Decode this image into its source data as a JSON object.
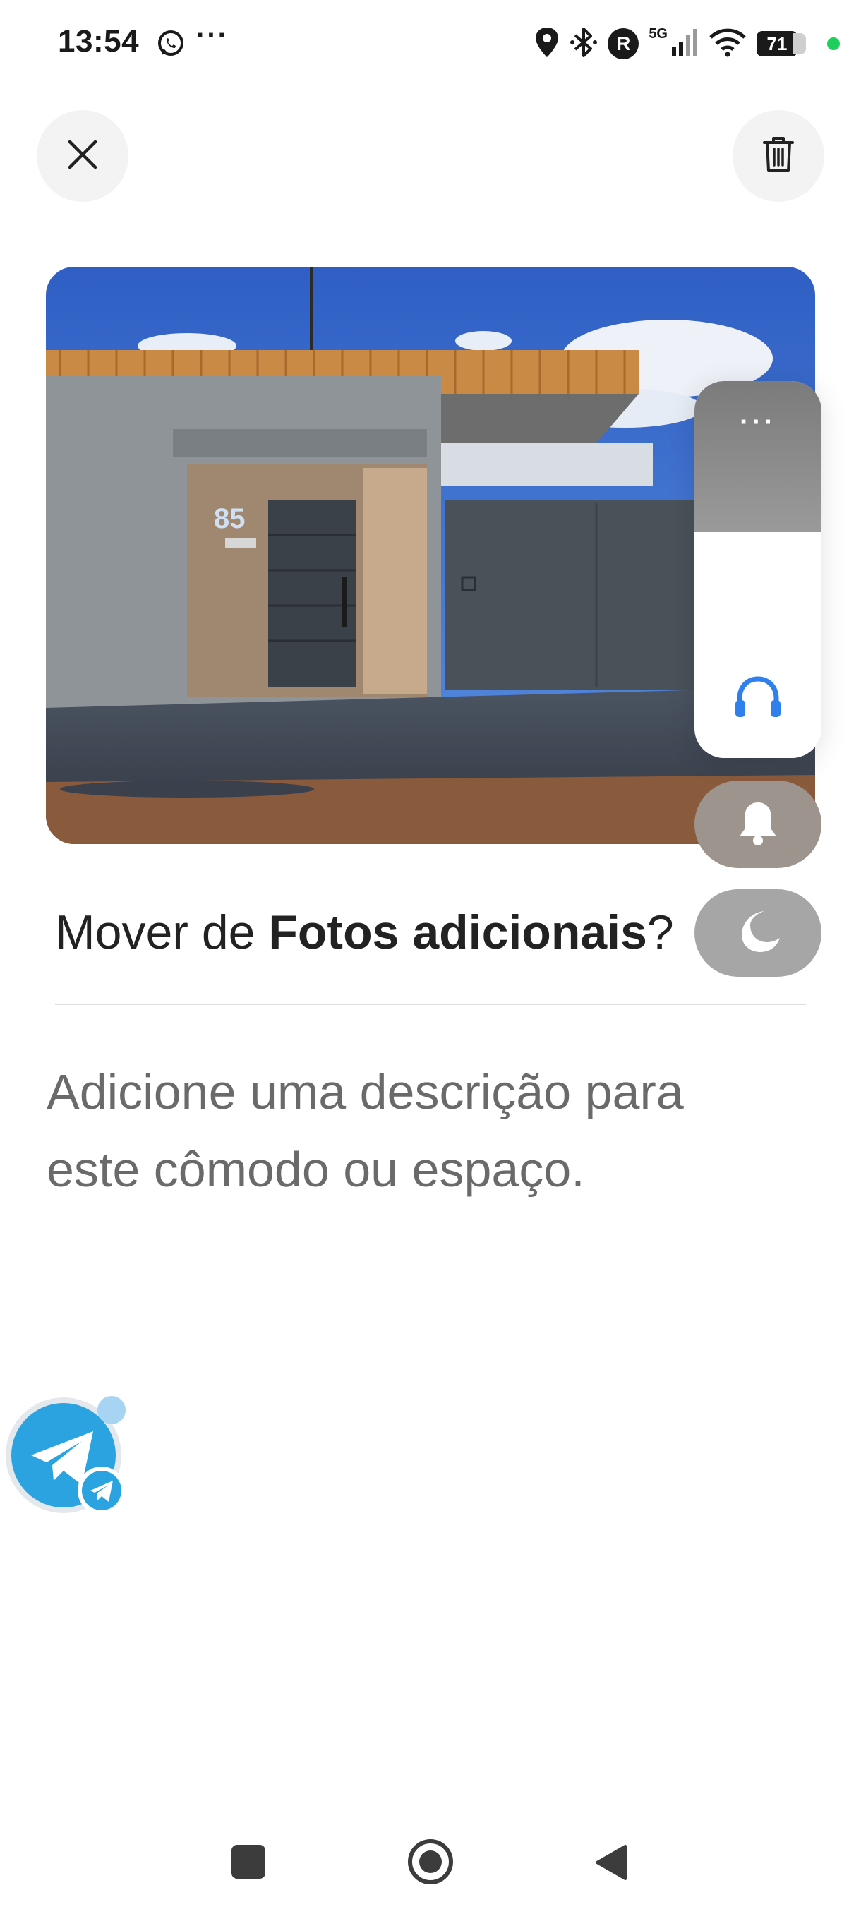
{
  "status_bar": {
    "time": "13:54",
    "more": "···",
    "network": "5G",
    "r_badge": "R",
    "battery": "71"
  },
  "header": {
    "close_icon": "close-icon",
    "delete_icon": "trash-icon"
  },
  "photo": {
    "house_number": "85"
  },
  "floating_panel": {
    "more": "···",
    "items": [
      "headphones-icon",
      "bell-icon",
      "moon-icon"
    ]
  },
  "title": {
    "prefix": "Mover de ",
    "bold": "Fotos adicionais",
    "suffix": "?"
  },
  "description": {
    "placeholder": "Adicione uma descrição para este cômodo ou espaço."
  },
  "colors": {
    "accent_blue": "#2f80ed",
    "telegram": "#2aa3e0"
  }
}
